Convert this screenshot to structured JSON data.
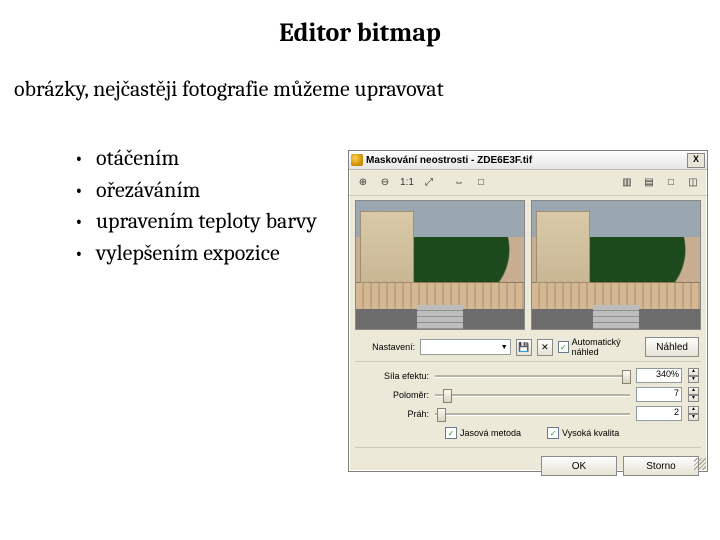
{
  "slide": {
    "title": "Editor bitmap",
    "subtitle": "obrázky, nejčastěji fotografie můžeme upravovat",
    "bullets": [
      "otáčením",
      "ořezáváním",
      "upravením teploty barvy",
      "vylepšením expozice"
    ]
  },
  "dialog": {
    "title": "Maskování neostrosti - ZDE6E3F.tif",
    "close": "X",
    "toolbar_left": [
      "⊕",
      "⊖",
      "1:1",
      "⤢",
      "",
      "⇔",
      "□"
    ],
    "toolbar_right": [
      "▥",
      "▤",
      "□",
      "◫"
    ],
    "settings_label": "Nastavení:",
    "settings_value": "",
    "auto_preview_label": "Automatický náhled",
    "preview_btn": "Náhled",
    "sliders": [
      {
        "label": "Síla efektu:",
        "value": "340%",
        "pos": 96
      },
      {
        "label": "Poloměr:",
        "value": "7",
        "pos": 4
      },
      {
        "label": "Práh:",
        "value": "2",
        "pos": 1
      }
    ],
    "checkboxes": [
      {
        "label": "Jasová metoda",
        "checked": true
      },
      {
        "label": "Vysoká kvalita",
        "checked": true
      }
    ],
    "ok": "OK",
    "cancel": "Storno"
  }
}
